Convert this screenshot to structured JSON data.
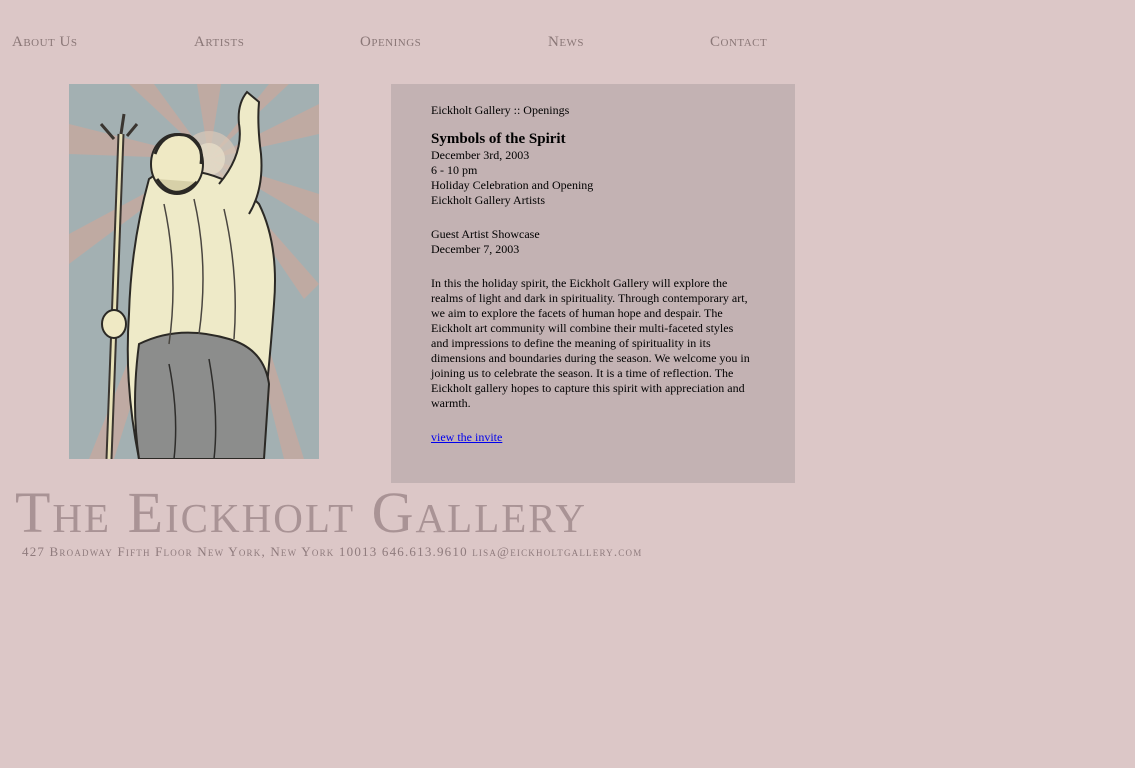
{
  "nav": {
    "items": [
      {
        "label": "About Us"
      },
      {
        "label": "Artists"
      },
      {
        "label": "Openings"
      },
      {
        "label": "News"
      },
      {
        "label": "Contact"
      }
    ]
  },
  "panel": {
    "breadcrumb": "Eickholt Gallery :: Openings",
    "event_title": "Symbols of the Spirit",
    "event_date": "December 3rd, 2003",
    "event_time": "6 - 10 pm",
    "event_desc": "Holiday Celebration and Opening",
    "event_artists": "Eickholt Gallery Artists",
    "guest_title": "Guest Artist Showcase",
    "guest_date": "December 7, 2003",
    "body": "In this the holiday spirit, the Eickholt Gallery will explore the realms of light and dark in spirituality. Through contemporary art, we aim to explore the facets of human hope and despair. The Eickholt art community will combine their multi-faceted styles and impressions to define the meaning of spirituality in its dimensions and boundaries during the season. We welcome you in joining us to celebrate the season. It is a time of reflection. The Eickholt gallery hopes to capture this spirit with appreciation and warmth.",
    "invite_link": "view the invite"
  },
  "footer": {
    "gallery_name": "The Eickholt Gallery",
    "address": "427 Broadway Fifth Floor New York, New York 10013 646.613.9610 lisa@eickholtgallery.com"
  },
  "colors": {
    "page_bg": "#dcc7c7",
    "panel_bg": "#c3b2b3",
    "nav_text": "#8a7777",
    "logo_text": "#a99395",
    "link": "#0000ee"
  }
}
